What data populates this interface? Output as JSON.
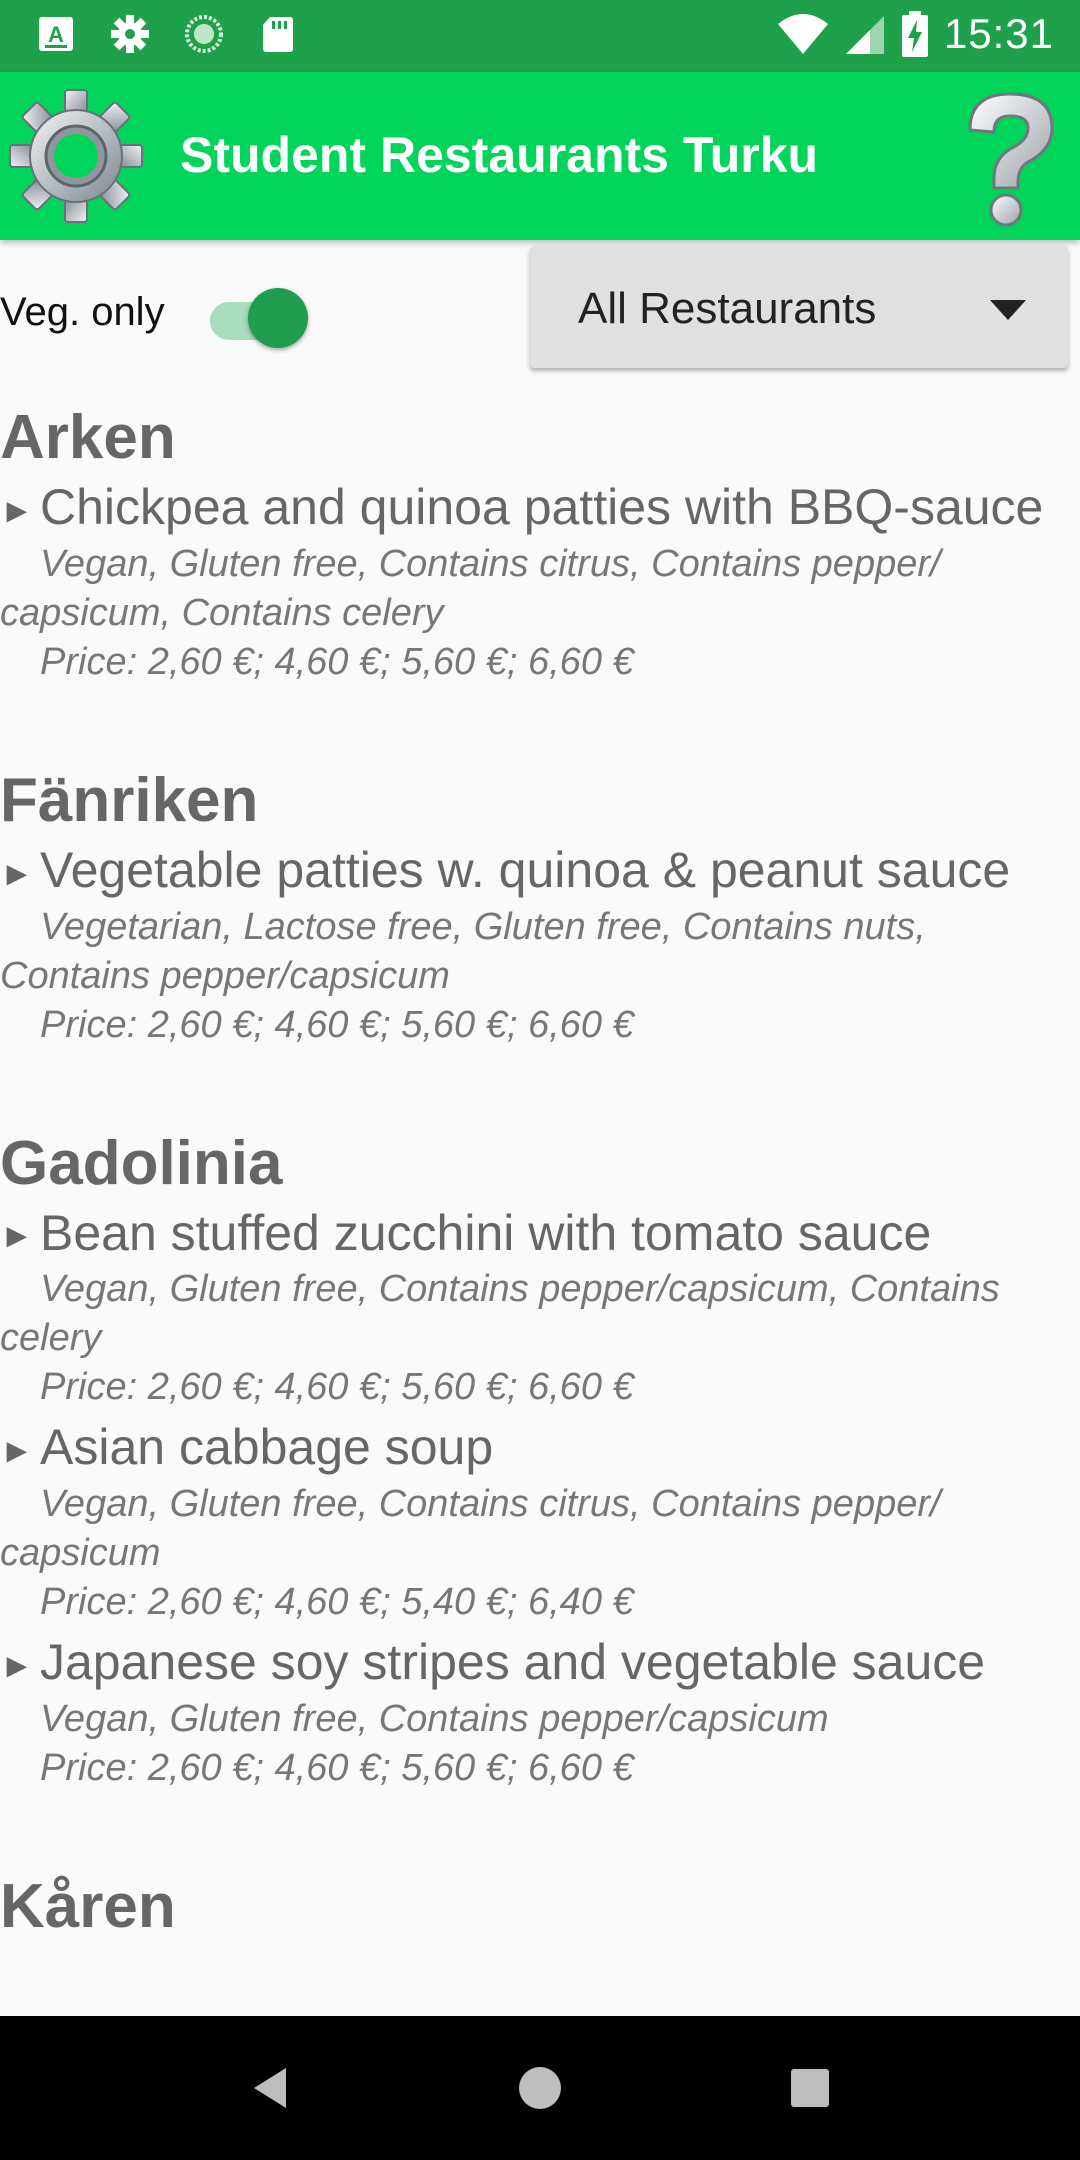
{
  "status_bar": {
    "time": "15:31",
    "left_icons": [
      "text-a-icon",
      "gear-icon",
      "sync-icon",
      "sd-card-icon"
    ],
    "right_icons": [
      "wifi-icon",
      "cell-signal-icon",
      "battery-charging-icon"
    ]
  },
  "app_bar": {
    "title": "Student Restaurants Turku",
    "settings_icon": "gear-icon",
    "help_icon": "question-mark-icon"
  },
  "filters": {
    "veg_label": "Veg. only",
    "veg_only": true,
    "restaurant_select": "All Restaurants"
  },
  "restaurants": [
    {
      "name": "Arken",
      "dishes": [
        {
          "name": "Chickpea and quinoa patties with BBQ-sauce",
          "diet_line1": "Vegan, Gluten free, Contains citrus, Contains pepper/",
          "diet_line2": "capsicum, Contains celery",
          "price": "Price: 2,60 €; 4,60 €; 5,60 €; 6,60 €"
        }
      ]
    },
    {
      "name": "Fänriken",
      "dishes": [
        {
          "name": "Vegetable patties w. quinoa & peanut sauce",
          "diet_line1": "Vegetarian, Lactose free, Gluten free, Contains nuts,",
          "diet_line2": "Contains pepper/capsicum",
          "price": "Price: 2,60 €; 4,60 €; 5,60 €; 6,60 €"
        }
      ]
    },
    {
      "name": "Gadolinia",
      "dishes": [
        {
          "name": "Bean stuffed zucchini with tomato sauce",
          "diet_line1": "Vegan, Gluten free, Contains pepper/capsicum, Contains",
          "diet_line2": "celery",
          "price": "Price: 2,60 €; 4,60 €; 5,60 €; 6,60 €"
        },
        {
          "name": "Asian cabbage soup",
          "diet_line1": "Vegan, Gluten free, Contains citrus, Contains pepper/",
          "diet_line2": "capsicum",
          "price": "Price: 2,60 €; 4,60 €; 5,40 €; 6,40 €"
        },
        {
          "name": "Japanese soy stripes and vegetable sauce",
          "diet_line1": "Vegan, Gluten free, Contains pepper/capsicum",
          "price": "Price: 2,60 €; 4,60 €; 5,60 €; 6,60 €"
        }
      ]
    },
    {
      "name": "Kåren",
      "dishes": []
    }
  ],
  "nav_bar": {
    "buttons": [
      "back-icon",
      "home-icon",
      "recents-icon"
    ]
  },
  "colors": {
    "status_bar": "#1fa04a",
    "app_bar": "#00d45a",
    "switch_on": "#1e9e4e",
    "text_gray": "#666666"
  }
}
